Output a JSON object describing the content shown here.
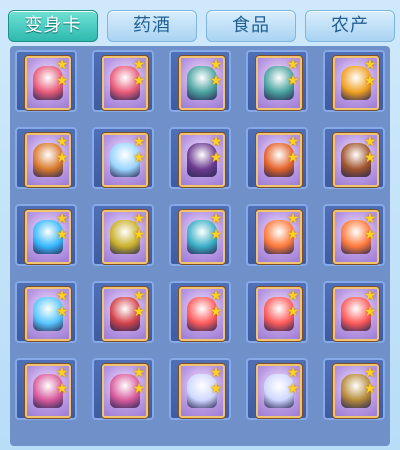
{
  "tabs": [
    {
      "label": "变身卡",
      "active": true
    },
    {
      "label": "药酒",
      "active": false
    },
    {
      "label": "食品",
      "active": false
    },
    {
      "label": "农产",
      "active": false
    }
  ],
  "grid": {
    "items": [
      {
        "stars": 2,
        "icon": "pink-warrior-icon",
        "accent": "#e85b7a"
      },
      {
        "stars": 2,
        "icon": "pink-warrior-icon",
        "accent": "#e85b7a"
      },
      {
        "stars": 2,
        "icon": "swordsman-icon",
        "accent": "#4aa3a0"
      },
      {
        "stars": 2,
        "icon": "swordsman-icon",
        "accent": "#4aa3a0"
      },
      {
        "stars": 2,
        "icon": "golden-beast-icon",
        "accent": "#f0a020"
      },
      {
        "stars": 2,
        "icon": "fox-warrior-icon",
        "accent": "#d97a2c"
      },
      {
        "stars": 2,
        "icon": "rabbit-spirit-icon",
        "accent": "#9bd6ff"
      },
      {
        "stars": 2,
        "icon": "dark-knight-icon",
        "accent": "#6b3a8f"
      },
      {
        "stars": 2,
        "icon": "fire-demon-icon",
        "accent": "#e3632a"
      },
      {
        "stars": 2,
        "icon": "archer-icon",
        "accent": "#a0542b"
      },
      {
        "stars": 2,
        "icon": "ice-dragon-icon",
        "accent": "#37b9ff"
      },
      {
        "stars": 2,
        "icon": "golden-guardian-icon",
        "accent": "#c9b12b"
      },
      {
        "stars": 2,
        "icon": "spirit-dancer-icon",
        "accent": "#3bb0c7"
      },
      {
        "stars": 2,
        "icon": "flame-fairy-icon",
        "accent": "#ff7a3b"
      },
      {
        "stars": 2,
        "icon": "flame-fairy-icon",
        "accent": "#ff7a3b"
      },
      {
        "stars": 2,
        "icon": "crystal-beast-icon",
        "accent": "#57c6ff"
      },
      {
        "stars": 2,
        "icon": "phoenix-icon",
        "accent": "#d2434a"
      },
      {
        "stars": 2,
        "icon": "red-monkey-icon",
        "accent": "#ff5b5b"
      },
      {
        "stars": 2,
        "icon": "red-monkey-icon",
        "accent": "#ff5b5b"
      },
      {
        "stars": 2,
        "icon": "red-monkey-icon",
        "accent": "#ff5b5b"
      },
      {
        "stars": 2,
        "icon": "wing-girl-icon",
        "accent": "#d85a9c"
      },
      {
        "stars": 2,
        "icon": "wing-girl-icon",
        "accent": "#d85a9c"
      },
      {
        "stars": 2,
        "icon": "white-wolf-icon",
        "accent": "#cfd7ff"
      },
      {
        "stars": 2,
        "icon": "white-wolf-icon",
        "accent": "#cfd7ff"
      },
      {
        "stars": 2,
        "icon": "armored-general-icon",
        "accent": "#b68a3a"
      }
    ]
  }
}
